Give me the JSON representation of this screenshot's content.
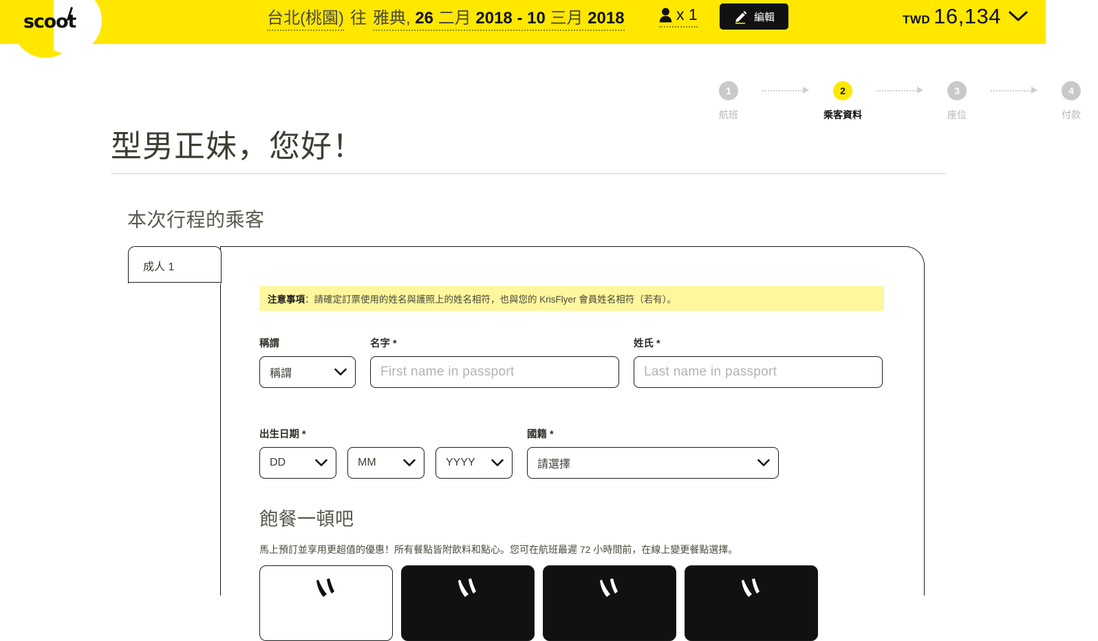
{
  "brand": {
    "name": "scoot",
    "accent": "#ffe700",
    "dark": "#111111"
  },
  "header": {
    "route_from": "台北(桃園)",
    "route_via": "往",
    "route_to_dates": "雅典, 26 二月 2018 - 10 三月 2018",
    "route_to": "雅典,",
    "date_out_day": "26",
    "date_out_month": "二月",
    "date_out_year": "2018",
    "dash": "-",
    "date_in_day": "10",
    "date_in_month": "三月",
    "date_in_year": "2018",
    "pax_count": "x 1",
    "pax_icon": "person-icon",
    "edit_label": "編輯",
    "edit_icon": "pencil-icon",
    "currency": "TWD",
    "amount": "16,134",
    "price_chevron": "chevron-down-icon"
  },
  "steps": [
    {
      "number": "1",
      "label": "航班",
      "active": false
    },
    {
      "number": "2",
      "label": "乘客資料",
      "active": true
    },
    {
      "number": "3",
      "label": "座位",
      "active": false
    },
    {
      "number": "4",
      "label": "付款",
      "active": false
    }
  ],
  "page": {
    "greeting": "型男正妹，您好！",
    "section_title": "本次行程的乘客"
  },
  "passenger_tab": {
    "label": "成人 1"
  },
  "notice": {
    "prefix": "注意事項",
    "text": "：請確定訂票使用的姓名與護照上的姓名相符，也與您的 KrisFlyer 會員姓名相符（若有）。"
  },
  "form": {
    "title_label": "稱謂",
    "title_value": "稱謂",
    "first_name_label": "名字 *",
    "first_name_placeholder": "First name in passport",
    "last_name_label": "姓氏 *",
    "last_name_placeholder": "Last name in passport",
    "dob_label": "出生日期 *",
    "dob_day": "DD",
    "dob_month": "MM",
    "dob_year": "YYYY",
    "nationality_label": "國籍 *",
    "nationality_value": "請選擇"
  },
  "meals": {
    "title": "飽餐一頓吧",
    "description": "馬上預訂並享用更超值的優惠！所有餐點皆附飲料和點心。您可在航班最遲 72 小時間前，在線上變更餐點選擇。",
    "cards": [
      {
        "icon": "meal-icon",
        "selected": true
      },
      {
        "icon": "meal-icon",
        "selected": false
      },
      {
        "icon": "meal-icon",
        "selected": false
      },
      {
        "icon": "meal-icon",
        "selected": false
      }
    ]
  }
}
